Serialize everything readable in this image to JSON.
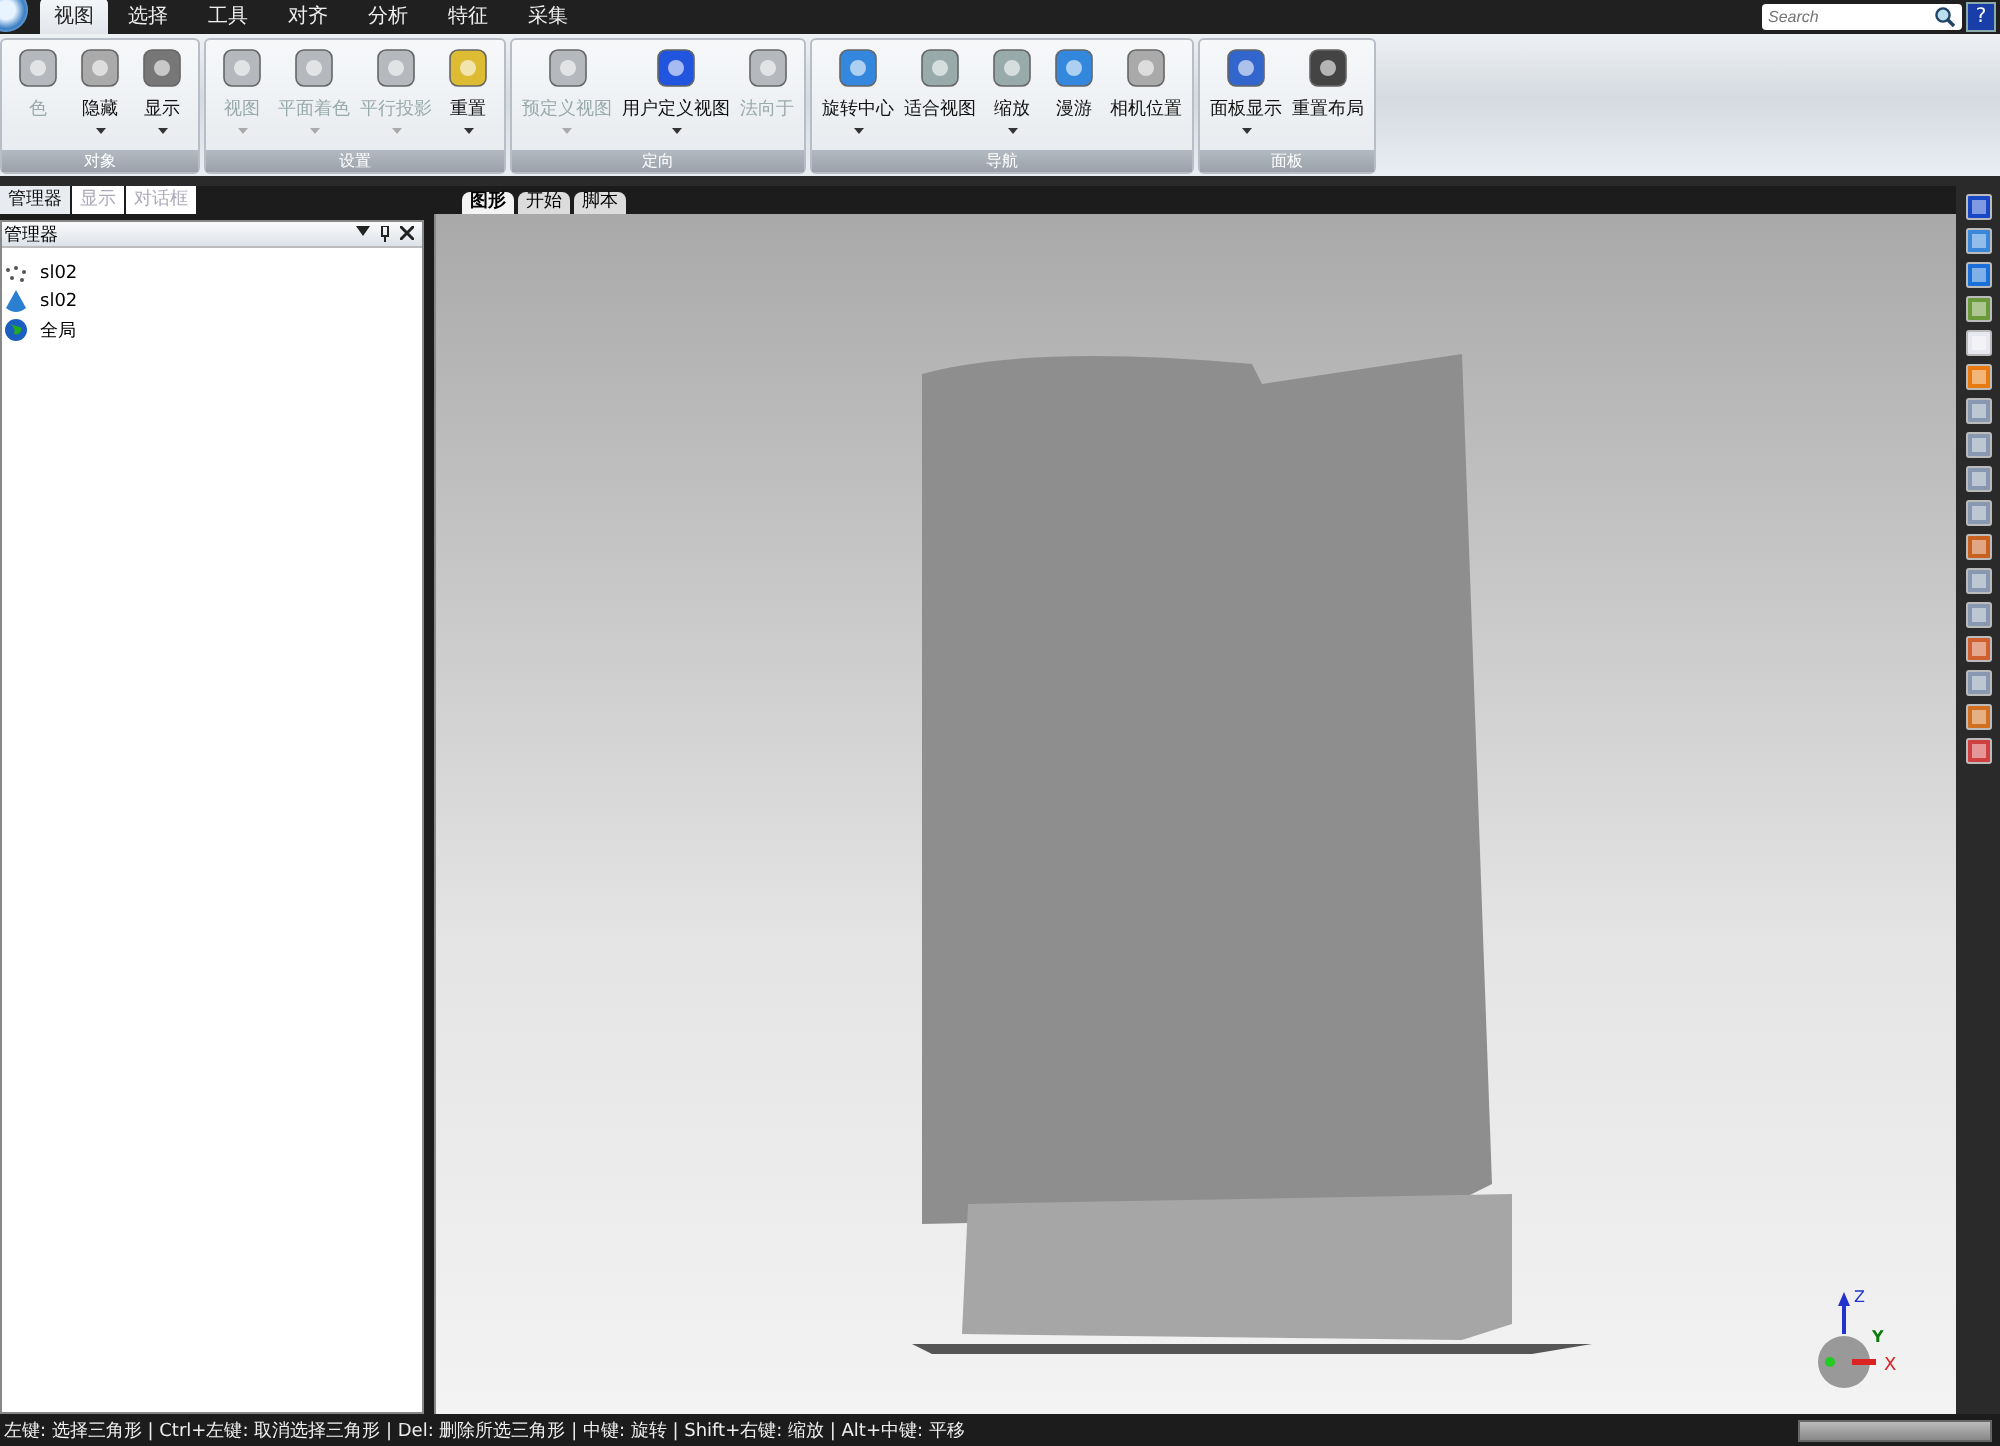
{
  "menu_tabs": [
    {
      "label": "视图",
      "selected": true
    },
    {
      "label": "选择",
      "selected": false
    },
    {
      "label": "工具",
      "selected": false
    },
    {
      "label": "对齐",
      "selected": false
    },
    {
      "label": "分析",
      "selected": false
    },
    {
      "label": "特征",
      "selected": false
    },
    {
      "label": "采集",
      "selected": false
    }
  ],
  "search": {
    "placeholder": "Search"
  },
  "help_button": "?",
  "ribbon_groups": [
    {
      "label": "对象",
      "buttons": [
        {
          "label": "色",
          "disabled": true,
          "dropdown": false
        },
        {
          "label": "隐藏",
          "disabled": false,
          "dropdown": true
        },
        {
          "label": "显示",
          "disabled": false,
          "dropdown": true
        }
      ]
    },
    {
      "label": "设置",
      "buttons": [
        {
          "label": "视图",
          "disabled": true,
          "dropdown": true
        },
        {
          "label": "平面着色",
          "disabled": true,
          "dropdown": true
        },
        {
          "label": "平行投影",
          "disabled": true,
          "dropdown": true
        },
        {
          "label": "重置",
          "disabled": false,
          "dropdown": true
        }
      ]
    },
    {
      "label": "定向",
      "buttons": [
        {
          "label": "预定义视图",
          "disabled": true,
          "dropdown": true
        },
        {
          "label": "用户定义视图",
          "disabled": false,
          "dropdown": true
        },
        {
          "label": "法向于",
          "disabled": true,
          "dropdown": false
        }
      ]
    },
    {
      "label": "导航",
      "buttons": [
        {
          "label": "旋转中心",
          "disabled": false,
          "dropdown": true
        },
        {
          "label": "适合视图",
          "disabled": false,
          "dropdown": false
        },
        {
          "label": "缩放",
          "disabled": false,
          "dropdown": true
        },
        {
          "label": "漫游",
          "disabled": false,
          "dropdown": false
        },
        {
          "label": "相机位置",
          "disabled": false,
          "dropdown": false
        }
      ]
    },
    {
      "label": "面板",
      "buttons": [
        {
          "label": "面板显示",
          "disabled": false,
          "dropdown": true
        },
        {
          "label": "重置布局",
          "disabled": false,
          "dropdown": false
        }
      ]
    }
  ],
  "side_panel": {
    "tabs": [
      {
        "label": "管理器",
        "selected": true,
        "disabled": false
      },
      {
        "label": "显示",
        "selected": false,
        "disabled": true
      },
      {
        "label": "对话框",
        "selected": false,
        "disabled": true
      }
    ],
    "title": "管理器",
    "items": [
      {
        "label": "sl02",
        "kind": "points"
      },
      {
        "label": "sl02",
        "kind": "mesh"
      },
      {
        "label": "全局",
        "kind": "globe"
      }
    ]
  },
  "view_tabs": [
    {
      "label": "图形",
      "selected": true
    },
    {
      "label": "开始",
      "selected": false
    },
    {
      "label": "脚本",
      "selected": false
    }
  ],
  "axes": {
    "z": "Z",
    "y": "Y",
    "x": "X"
  },
  "status_bar": {
    "text": "左键: 选择三角形 | Ctrl+左键: 取消选择三角形 | Del: 删除所选三角形 | 中键: 旋转 | Shift+右键: 缩放 | Alt+中键: 平移"
  }
}
